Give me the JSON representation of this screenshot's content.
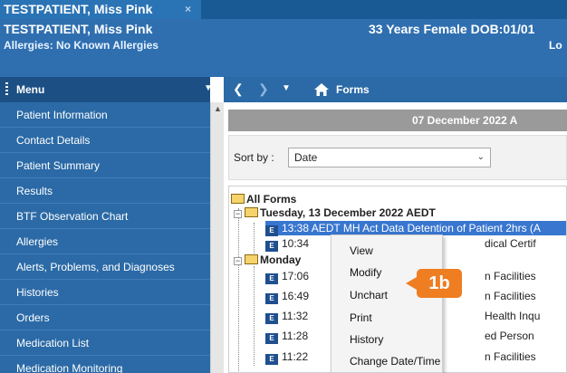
{
  "tab": {
    "label": "TESTPATIENT, Miss Pink",
    "close_glyph": "×"
  },
  "banner": {
    "name": "TESTPATIENT, Miss Pink",
    "allergies": "Allergies: No Known Allergies",
    "demographics": "33 Years Female DOB:01/01",
    "location": "Lo"
  },
  "menu": {
    "title": "Menu",
    "items": [
      "Patient Information",
      "Contact Details",
      "Patient Summary",
      "Results",
      "BTF Observation Chart",
      "Allergies",
      "Alerts, Problems, and Diagnoses",
      "Histories",
      "Orders",
      "Medication List",
      "Medication Monitoring"
    ]
  },
  "nav": {
    "title": "Forms"
  },
  "content": {
    "date_header": "07 December 2022 A",
    "sort_label": "Sort by :",
    "sort_value": "Date"
  },
  "tree": {
    "root": "All Forms",
    "groups": [
      {
        "label": "Tuesday, 13 December 2022 AEDT",
        "rows": [
          {
            "time": "13:38",
            "text": "AEDT MH Act Data Detention of Patient 2hrs (A"
          },
          {
            "time": "10:34",
            "text": "dical Certif"
          }
        ]
      },
      {
        "label": "Monday",
        "rows": [
          {
            "time": "17:06",
            "text": "n Facilities"
          },
          {
            "time": "16:49",
            "text": "n Facilities"
          },
          {
            "time": "11:32",
            "text": "Health Inqu"
          },
          {
            "time": "11:28",
            "text": "ed Person"
          },
          {
            "time": "11:22",
            "text": "n Facilities"
          }
        ]
      }
    ]
  },
  "context_menu": {
    "items": [
      "View",
      "Modify",
      "Unchart",
      "Print",
      "History",
      "Change Date/Time"
    ]
  },
  "callout": {
    "label": "1b",
    "color": "#ef7d22"
  }
}
